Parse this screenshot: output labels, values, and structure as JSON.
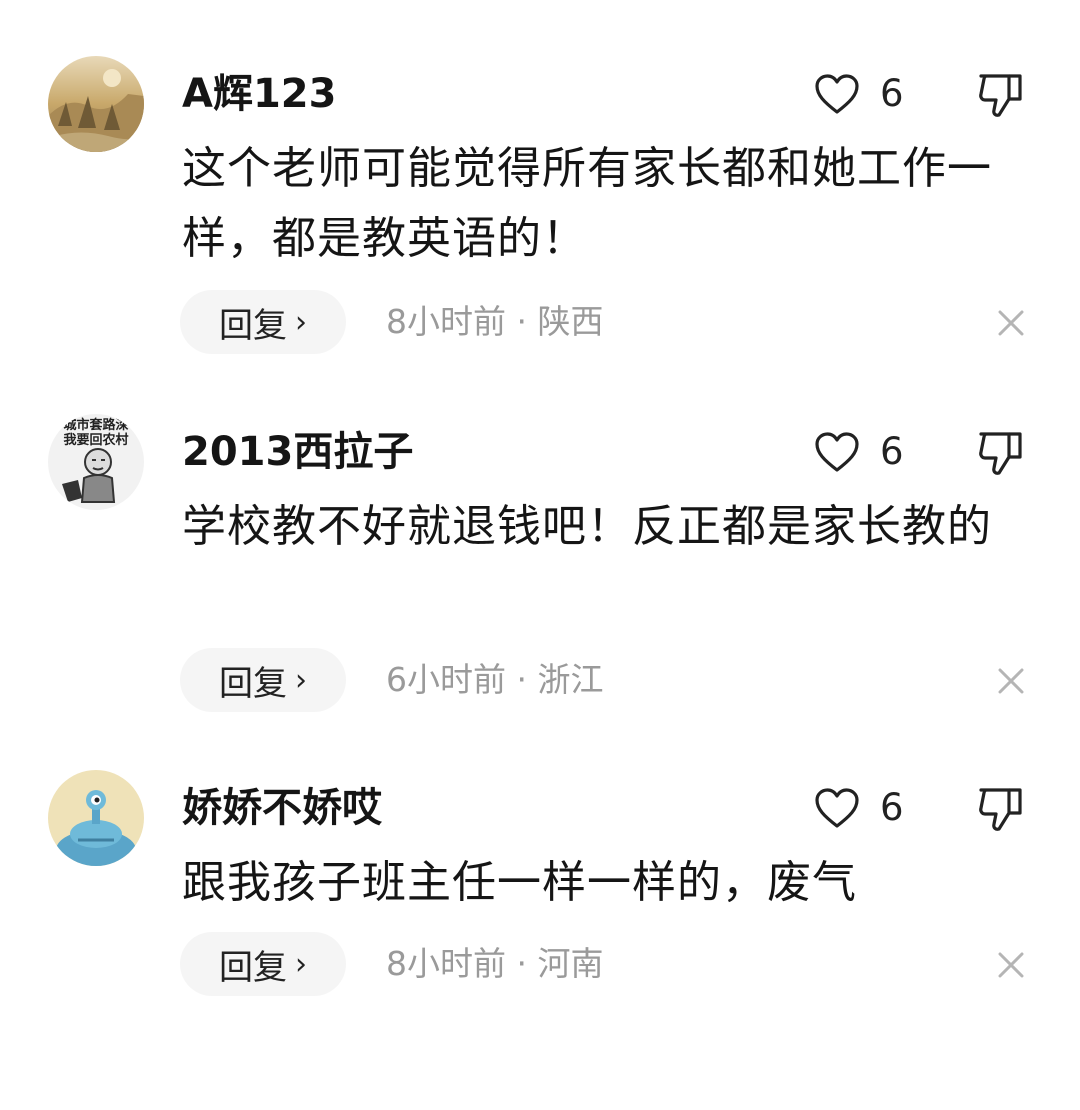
{
  "comments": [
    {
      "username": "A辉123",
      "like_count": "6",
      "text": "这个老师可能觉得所有家长都和她工作一样，都是教英语的！",
      "reply_label": "回复",
      "reply_chevron": "›",
      "time": "8小时前",
      "location": "陕西",
      "avatar_icon": "landscape-photo-avatar"
    },
    {
      "username": "2013西拉子",
      "like_count": "6",
      "text": "学校教不好就退钱吧！反正都是家长教的",
      "reply_label": "回复",
      "reply_chevron": "›",
      "time": "6小时前",
      "location": "浙江",
      "avatar_icon": "meme-avatar",
      "avatar_caption_line1": "城市套路深",
      "avatar_caption_line2": "我要回农村"
    },
    {
      "username": "娇娇不娇哎",
      "like_count": "6",
      "text": "跟我孩子班主任一样一样的，废气",
      "reply_label": "回复",
      "reply_chevron": "›",
      "time": "8小时前",
      "location": "河南",
      "avatar_icon": "alien-cartoon-avatar"
    }
  ],
  "separator": " · ",
  "icons": {
    "like": "heart-outline-icon",
    "dislike": "thumbs-down-outline-icon",
    "close": "close-x-icon"
  },
  "colors": {
    "text": "#151515",
    "meta": "#9a9a9a",
    "reply_bg": "#f5f5f5"
  }
}
